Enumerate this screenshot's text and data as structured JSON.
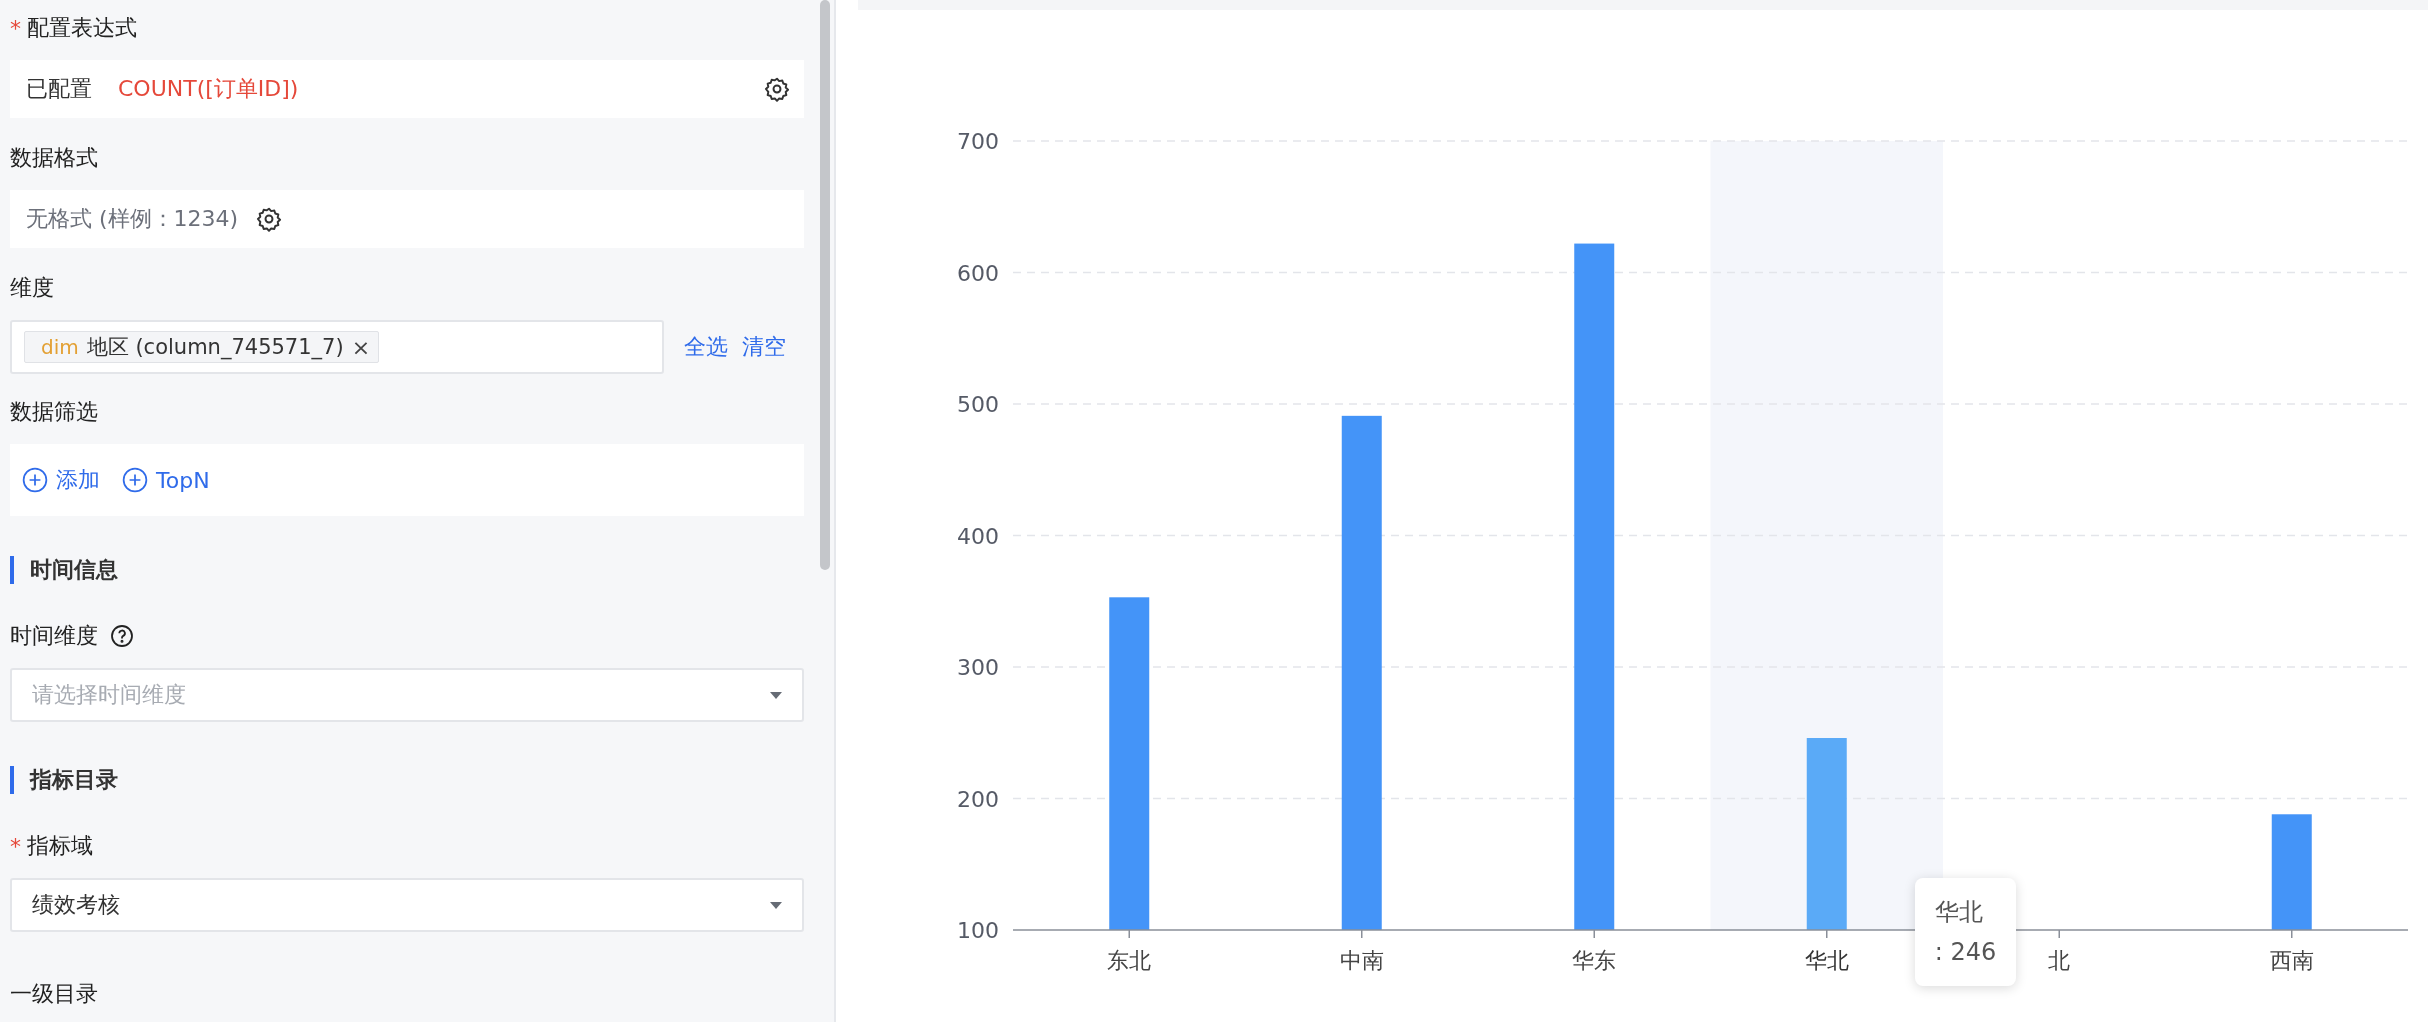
{
  "form": {
    "items": [
      {
        "kind": "expression",
        "required_mark": "*",
        "label": "配置表达式",
        "status": "已配置",
        "value": "COUNT([订单ID])"
      },
      {
        "kind": "format",
        "label": "数据格式",
        "value": "无格式 (样例：1234)"
      },
      {
        "kind": "dimension",
        "label": "维度",
        "tag_type": "dim",
        "tag": "地区 (column_745571_7)",
        "remove": "×",
        "actions": [
          "全选",
          "清空"
        ]
      },
      {
        "kind": "filter",
        "label": "数据筛选",
        "buttons": [
          "添加",
          "TopN"
        ]
      },
      {
        "kind": "section",
        "label": "时间信息"
      },
      {
        "kind": "select",
        "label": "时间维度",
        "help": true,
        "placeholder": "请选择时间维度"
      },
      {
        "kind": "section",
        "label": "指标目录"
      },
      {
        "kind": "select",
        "required_mark": "*",
        "label": "指标域",
        "value": "绩效考核"
      },
      {
        "kind": "label",
        "label": "一级目录"
      }
    ]
  },
  "chart_panel": {
    "chart_data": {
      "type": "bar",
      "categories": [
        "东北",
        "中南",
        "华东",
        "华北",
        "北",
        "西南"
      ],
      "series": [
        {
          "color": "#4494f8",
          "values": [
            353,
            491,
            622,
            null,
            null,
            188
          ]
        },
        {
          "color": "#5aaaf7",
          "values": [
            null,
            null,
            null,
            246,
            null,
            null
          ]
        }
      ],
      "ylim": [
        100,
        700
      ],
      "yticks": [
        100,
        200,
        300,
        400,
        500,
        600,
        700
      ],
      "grid": true,
      "bands": [
        {
          "axis": "x",
          "from": "华北",
          "to": "华北",
          "color": "#f4f6fb"
        }
      ]
    },
    "hover": {
      "selected": [
        false,
        false,
        false,
        true,
        false,
        false
      ],
      "tooltip_title": "华北",
      "tooltip_value": ": 246"
    }
  }
}
